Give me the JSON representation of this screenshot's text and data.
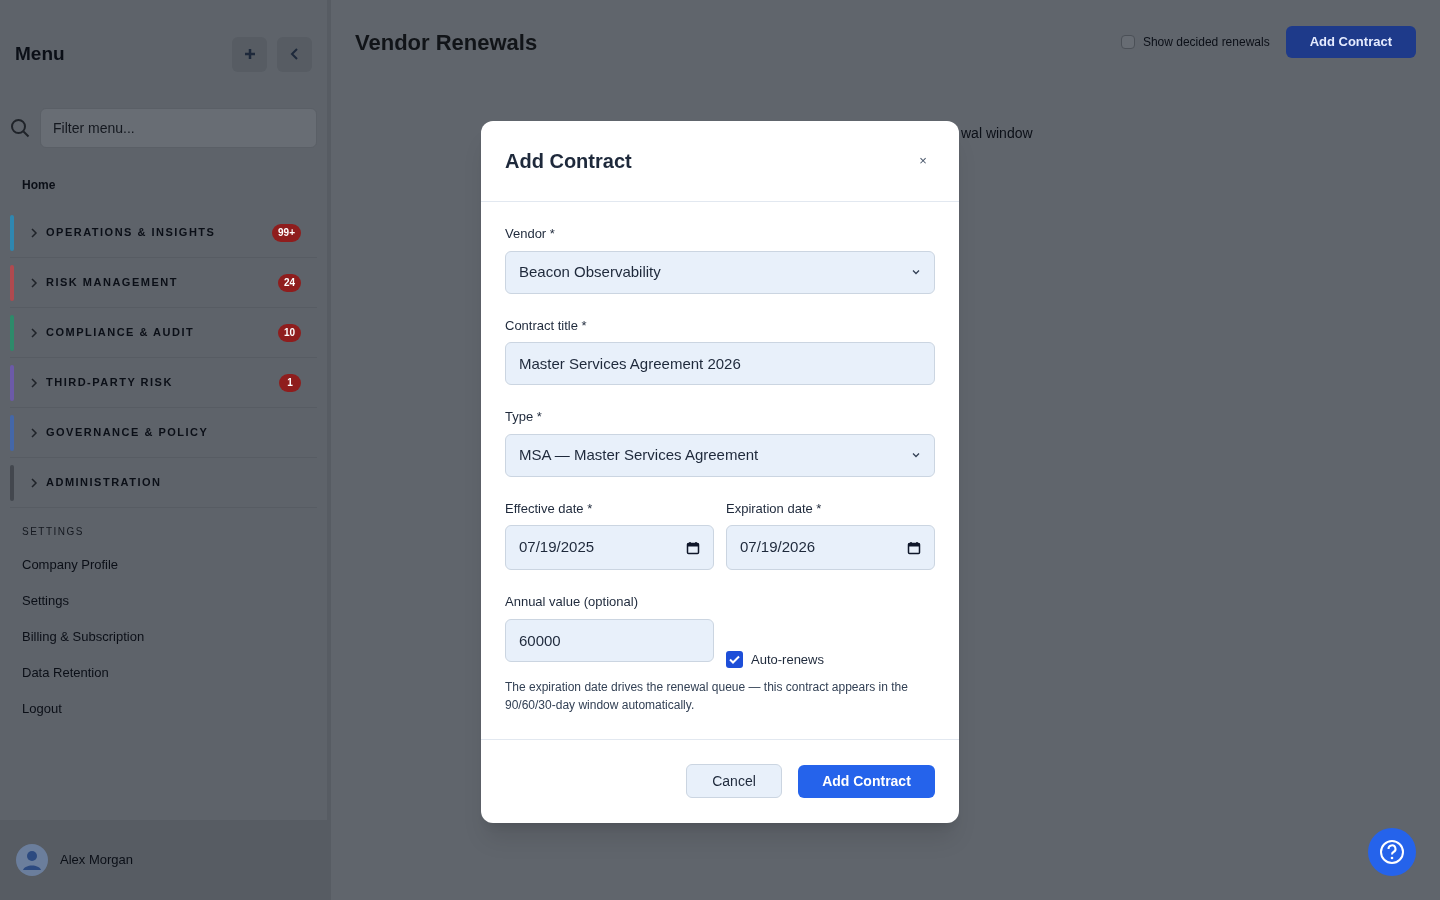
{
  "sidebar": {
    "title": "Menu",
    "filter": {
      "placeholder": "Filter menu..."
    },
    "home": "Home",
    "groups": [
      {
        "label": "OPERATIONS & INSIGHTS",
        "badge": "99+",
        "color": "#2f87b0",
        "expanded": false
      },
      {
        "label": "RISK MANAGEMENT",
        "badge": "24",
        "color": "#b04a4f",
        "expanded": false
      },
      {
        "label": "COMPLIANCE & AUDIT",
        "badge": "10",
        "color": "#2e8a6a",
        "expanded": false
      },
      {
        "label": "THIRD-PARTY RISK",
        "badge": "1",
        "color": "#6c5aa8",
        "expanded": false
      },
      {
        "label": "GOVERNANCE & POLICY",
        "color": "#4467a8",
        "expanded": false
      },
      {
        "label": "ADMINISTRATION",
        "color": "#43474e",
        "expanded": false
      }
    ],
    "settings_heading": "SETTINGS",
    "settings_items": [
      "Company Profile",
      "Settings",
      "Billing & Subscription",
      "Data Retention",
      "Logout"
    ],
    "user": {
      "name": "Alex Morgan"
    }
  },
  "page": {
    "title": "Vendor Renewals",
    "show_decided": {
      "label": "Show decided renewals",
      "checked": false
    },
    "add_button": "Add Contract",
    "partial_text": "wal window"
  },
  "modal": {
    "title": "Add Contract",
    "close": "×",
    "vendor": {
      "label": "Vendor *",
      "value": "Beacon Observability"
    },
    "contract_title": {
      "label": "Contract title *",
      "value": "Master Services Agreement 2026"
    },
    "type": {
      "label": "Type *",
      "value": "MSA — Master Services Agreement"
    },
    "effective_date": {
      "label": "Effective date *",
      "value": "07/19/2025"
    },
    "expiration_date": {
      "label": "Expiration date *",
      "value": "07/19/2026"
    },
    "annual_value": {
      "label": "Annual value (optional)",
      "value": "60000"
    },
    "auto_renews": {
      "label": "Auto-renews",
      "checked": true
    },
    "hint": "The expiration date drives the renewal queue — this contract appears in the 90/60/30-day window automatically.",
    "buttons": {
      "cancel": "Cancel",
      "submit": "Add Contract"
    }
  }
}
